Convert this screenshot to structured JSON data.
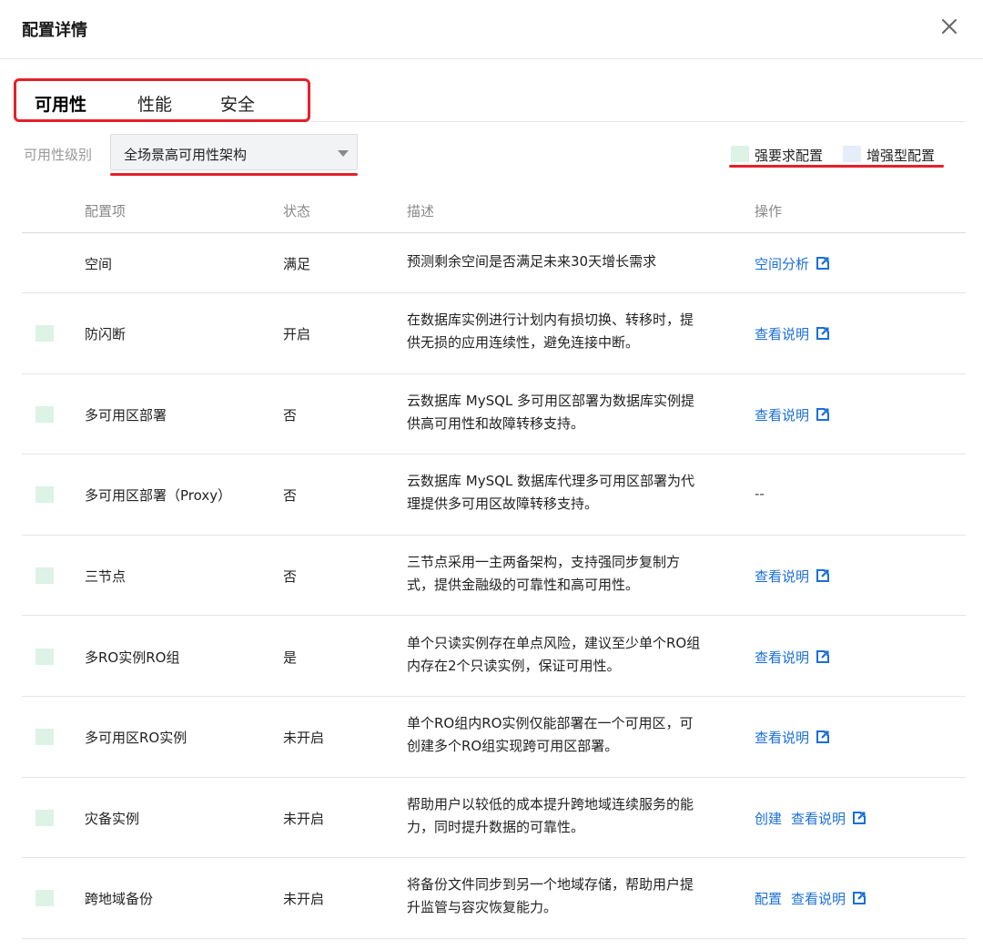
{
  "dialog": {
    "title": "配置详情"
  },
  "tabs": [
    {
      "label": "可用性",
      "active": true
    },
    {
      "label": "性能",
      "active": false
    },
    {
      "label": "安全",
      "active": false
    }
  ],
  "filter": {
    "label": "可用性级别",
    "selected": "全场景高可用性架构"
  },
  "legend": [
    {
      "label": "强要求配置",
      "color": "#dcf3e6"
    },
    {
      "label": "增强型配置",
      "color": "#e4edf8"
    }
  ],
  "table": {
    "headers": [
      "配置项",
      "状态",
      "描述",
      "操作"
    ],
    "rows": [
      {
        "name": "空间",
        "status": "满足",
        "desc": [
          "预测剩余空间是否满足未来30天增长需求"
        ],
        "actions": [
          "空间分析"
        ],
        "external": true,
        "swatch": ""
      },
      {
        "name": "防闪断",
        "status": "开启",
        "desc": [
          "在数据库实例进行计划内有损切换、转移时，提",
          "供无损的应用连续性，避免连接中断。"
        ],
        "actions": [
          "查看说明"
        ],
        "external": true,
        "swatch": "#dcf3e6"
      },
      {
        "name": "多可用区部署",
        "status": "否",
        "desc": [
          "云数据库 MySQL 多可用区部署为数据库实例提",
          "供高可用性和故障转移支持。"
        ],
        "actions": [
          "查看说明"
        ],
        "external": true,
        "swatch": "#dcf3e6"
      },
      {
        "name": "多可用区部署（Proxy）",
        "status": "否",
        "desc": [
          "云数据库 MySQL 数据库代理多可用区部署为代",
          "理提供多可用区故障转移支持。"
        ],
        "actions": [
          "--"
        ],
        "external": false,
        "swatch": "#dcf3e6"
      },
      {
        "name": "三节点",
        "status": "否",
        "desc": [
          "三节点采用一主两备架构，支持强同步复制方",
          "式，提供金融级的可靠性和高可用性。"
        ],
        "actions": [
          "查看说明"
        ],
        "external": true,
        "swatch": "#dcf3e6"
      },
      {
        "name": "多RO实例RO组",
        "status": "是",
        "desc": [
          "单个只读实例存在单点风险，建议至少单个RO组",
          "内存在2个只读实例，保证可用性。"
        ],
        "actions": [
          "查看说明"
        ],
        "external": true,
        "swatch": "#dcf3e6"
      },
      {
        "name": "多可用区RO实例",
        "status": "未开启",
        "desc": [
          "单个RO组内RO实例仅能部署在一个可用区，可",
          "创建多个RO组实现跨可用区部署。"
        ],
        "actions": [
          "查看说明"
        ],
        "external": true,
        "swatch": "#dcf3e6"
      },
      {
        "name": "灾备实例",
        "status": "未开启",
        "desc": [
          "帮助用户以较低的成本提升跨地域连续服务的能",
          "力，同时提升数据的可靠性。"
        ],
        "actions": [
          "创建",
          "查看说明"
        ],
        "external": true,
        "swatch": "#dcf3e6"
      },
      {
        "name": "跨地域备份",
        "status": "未开启",
        "desc": [
          "将备份文件同步到另一个地域存储，帮助用户提",
          "升监管与容灾恢复能力。"
        ],
        "actions": [
          "配置",
          "查看说明"
        ],
        "external": true,
        "swatch": "#dcf3e6"
      }
    ]
  },
  "colors": {
    "link": "#1a6fd8",
    "highlight": "#e5202a"
  },
  "icons": {
    "close": "close-icon",
    "external": "external-link-icon",
    "dropdown": "caret-down-icon"
  }
}
